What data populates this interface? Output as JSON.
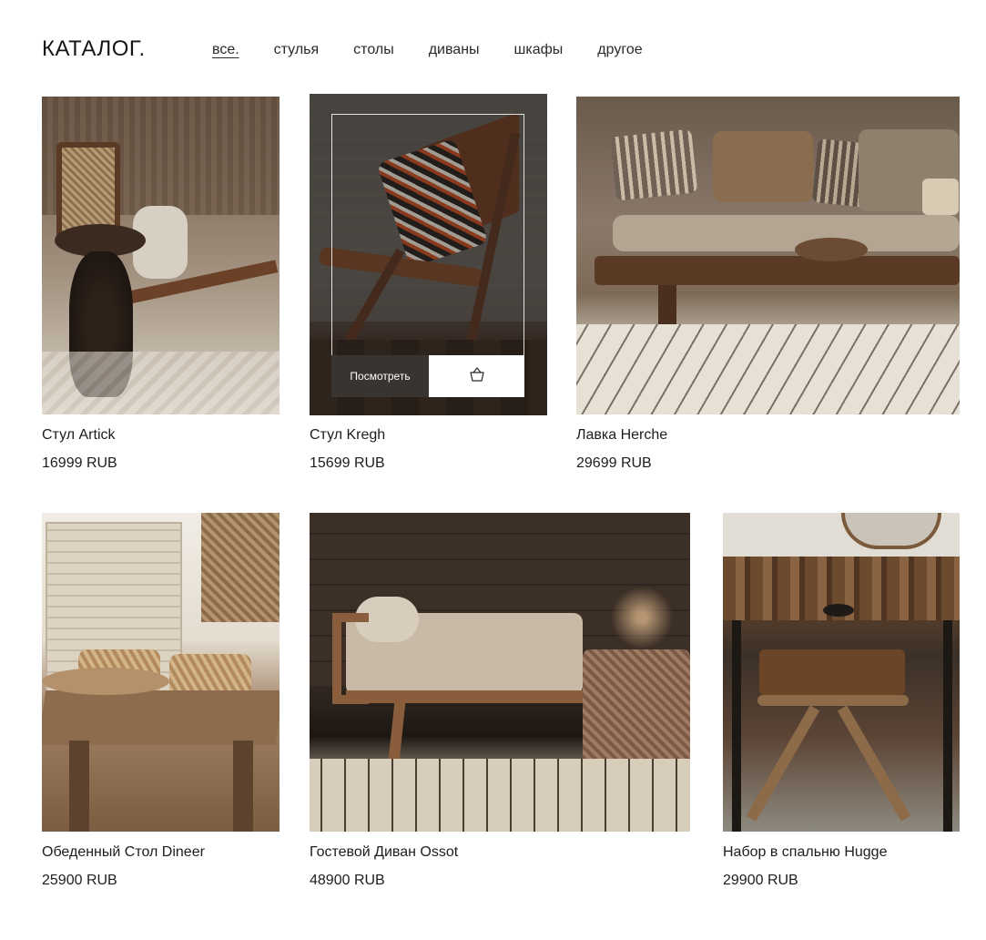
{
  "header": {
    "logo": "КАТАЛОГ.",
    "nav": [
      {
        "label": "все.",
        "active": true
      },
      {
        "label": "стулья",
        "active": false
      },
      {
        "label": "столы",
        "active": false
      },
      {
        "label": "диваны",
        "active": false
      },
      {
        "label": "шкафы",
        "active": false
      },
      {
        "label": "другое",
        "active": false
      }
    ]
  },
  "products": [
    {
      "title": "Стул Artick",
      "price": "16999 RUB"
    },
    {
      "title": "Стул Kregh",
      "price": "15699 RUB",
      "hover": {
        "view_label": "Посмотреть",
        "cart_icon": "basket-icon"
      }
    },
    {
      "title": "Лавка Herche",
      "price": "29699 RUB"
    },
    {
      "title": "Обеденный Стол Dineer",
      "price": "25900 RUB"
    },
    {
      "title": "Гостевой Диван Ossot",
      "price": "48900 RUB"
    },
    {
      "title": "Набор в спальню Hugge",
      "price": "29900 RUB"
    }
  ]
}
